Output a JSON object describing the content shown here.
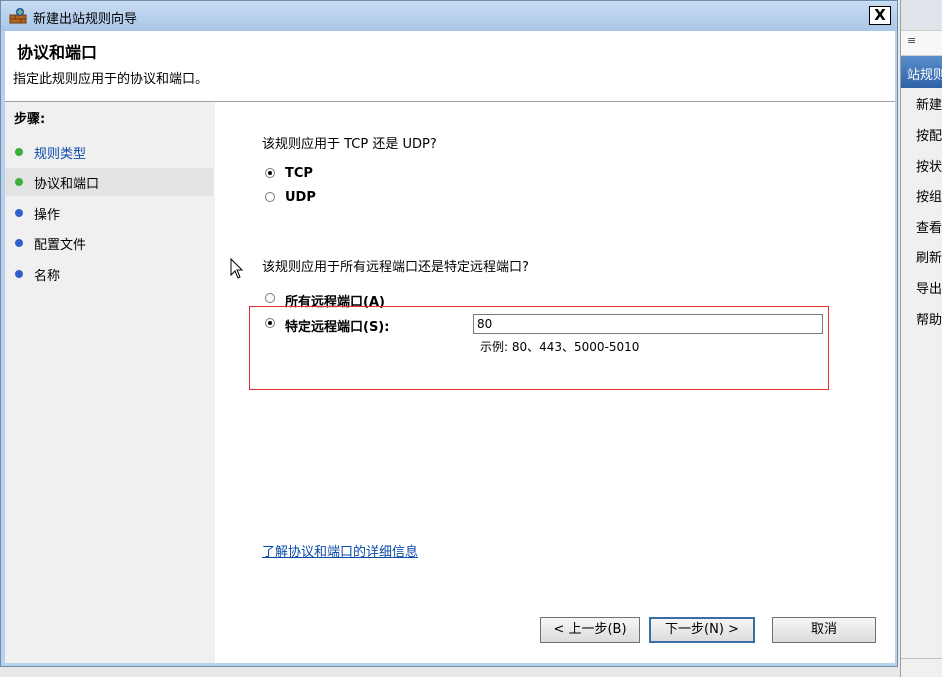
{
  "window": {
    "title": "新建出站规则向导",
    "close_label": "X",
    "header_title": "协议和端口",
    "header_subtitle": "指定此规则应用于的协议和端口。"
  },
  "steps": {
    "label": "步骤:",
    "items": [
      {
        "label": "规则类型",
        "state": "done"
      },
      {
        "label": "协议和端口",
        "state": "current"
      },
      {
        "label": "操作",
        "state": "pending"
      },
      {
        "label": "配置文件",
        "state": "pending"
      },
      {
        "label": "名称",
        "state": "pending"
      }
    ]
  },
  "protocol": {
    "question": "该规则应用于 TCP 还是 UDP?",
    "options": [
      {
        "label": "TCP",
        "selected": true
      },
      {
        "label": "UDP",
        "selected": false
      }
    ]
  },
  "ports": {
    "question": "该规则应用于所有远程端口还是特定远程端口?",
    "options": [
      {
        "label": "所有远程端口(A)",
        "selected": false
      },
      {
        "label": "特定远程端口(S):",
        "selected": true
      }
    ],
    "value": "80",
    "example": "示例: 80、443、5000-5010"
  },
  "learn_link": "了解协议和端口的详细信息",
  "buttons": {
    "back": "< 上一步(B)",
    "next": "下一步(N) >",
    "cancel": "取消"
  },
  "background_window": {
    "action_header": "站规则",
    "items": [
      "新建",
      "按配",
      "按状",
      "按组",
      "查看",
      "刷新",
      "导出",
      "帮助"
    ]
  },
  "colors": {
    "step_done": "#0a4aa8",
    "dot_done": "#3cae3c",
    "dot_pending": "#2d62c8",
    "highlight": "#e03030"
  }
}
